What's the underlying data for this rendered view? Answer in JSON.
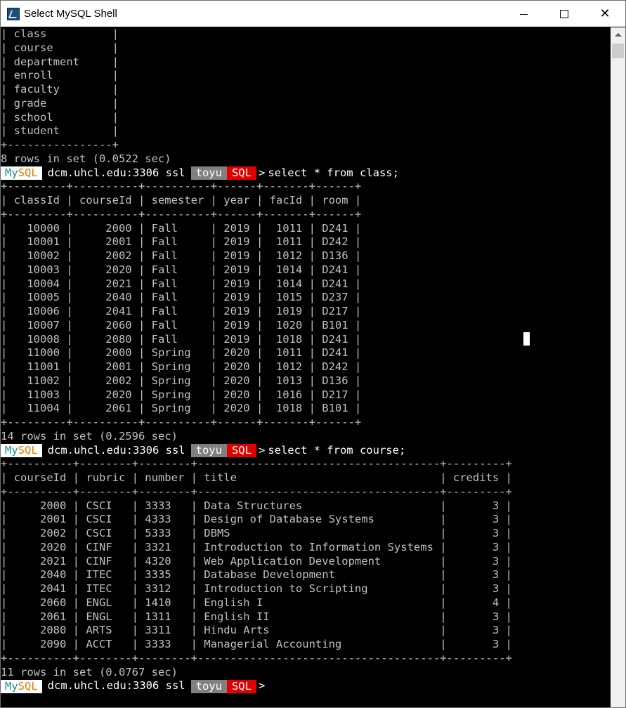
{
  "window": {
    "title": "Select MySQL Shell",
    "minimize_icon": "minimize-icon",
    "maximize_icon": "maximize-icon",
    "close_icon": "close-icon",
    "close_glyph": "✕"
  },
  "prompt": {
    "my": "My",
    "sql": "SQL",
    "host": "dcm.uhcl.edu:3306 ssl",
    "user": "toyu",
    "mode": "SQL",
    "arrow": ">",
    "colors": {
      "my": "#1c8c9c",
      "sql": "#e07b00",
      "user_bg": "#808080",
      "mode_bg": "#e00000"
    }
  },
  "terminal_lines": [
    {
      "type": "text",
      "text": "| class          |"
    },
    {
      "type": "text",
      "text": "| course         |"
    },
    {
      "type": "text",
      "text": "| department     |"
    },
    {
      "type": "text",
      "text": "| enroll         |"
    },
    {
      "type": "text",
      "text": "| faculty        |"
    },
    {
      "type": "text",
      "text": "| grade          |"
    },
    {
      "type": "text",
      "text": "| school         |"
    },
    {
      "type": "text",
      "text": "| student        |"
    },
    {
      "type": "text",
      "text": "+----------------+"
    },
    {
      "type": "text",
      "text": "8 rows in set (0.0522 sec)"
    },
    {
      "type": "prompt",
      "command": "select * from class;"
    },
    {
      "type": "text",
      "text": "+---------+----------+----------+------+-------+------+"
    },
    {
      "type": "text",
      "text": "| classId | courseId | semester | year | facId | room |"
    },
    {
      "type": "text",
      "text": "+---------+----------+----------+------+-------+------+"
    },
    {
      "type": "text",
      "text": "|   10000 |     2000 | Fall     | 2019 |  1011 | D241 |"
    },
    {
      "type": "text",
      "text": "|   10001 |     2001 | Fall     | 2019 |  1011 | D242 |"
    },
    {
      "type": "text",
      "text": "|   10002 |     2002 | Fall     | 2019 |  1012 | D136 |"
    },
    {
      "type": "text",
      "text": "|   10003 |     2020 | Fall     | 2019 |  1014 | D241 |"
    },
    {
      "type": "text",
      "text": "|   10004 |     2021 | Fall     | 2019 |  1014 | D241 |"
    },
    {
      "type": "text",
      "text": "|   10005 |     2040 | Fall     | 2019 |  1015 | D237 |"
    },
    {
      "type": "text",
      "text": "|   10006 |     2041 | Fall     | 2019 |  1019 | D217 |"
    },
    {
      "type": "text",
      "text": "|   10007 |     2060 | Fall     | 2019 |  1020 | B101 |"
    },
    {
      "type": "text",
      "text": "|   10008 |     2080 | Fall     | 2019 |  1018 | D241 |"
    },
    {
      "type": "text",
      "text": "|   11000 |     2000 | Spring   | 2020 |  1011 | D241 |"
    },
    {
      "type": "text",
      "text": "|   11001 |     2001 | Spring   | 2020 |  1012 | D242 |"
    },
    {
      "type": "text",
      "text": "|   11002 |     2002 | Spring   | 2020 |  1013 | D136 |"
    },
    {
      "type": "text",
      "text": "|   11003 |     2020 | Spring   | 2020 |  1016 | D217 |"
    },
    {
      "type": "text",
      "text": "|   11004 |     2061 | Spring   | 2020 |  1018 | B101 |"
    },
    {
      "type": "text",
      "text": "+---------+----------+----------+------+-------+------+"
    },
    {
      "type": "text",
      "text": "14 rows in set (0.2596 sec)"
    },
    {
      "type": "prompt",
      "command": "select * from course;"
    },
    {
      "type": "text",
      "text": "+----------+--------+--------+-------------------------------------+---------+"
    },
    {
      "type": "text",
      "text": "| courseId | rubric | number | title                               | credits |"
    },
    {
      "type": "text",
      "text": "+----------+--------+--------+-------------------------------------+---------+"
    },
    {
      "type": "text",
      "text": "|     2000 | CSCI   | 3333   | Data Structures                     |       3 |"
    },
    {
      "type": "text",
      "text": "|     2001 | CSCI   | 4333   | Design of Database Systems          |       3 |"
    },
    {
      "type": "text",
      "text": "|     2002 | CSCI   | 5333   | DBMS                                |       3 |"
    },
    {
      "type": "text",
      "text": "|     2020 | CINF   | 3321   | Introduction to Information Systems |       3 |"
    },
    {
      "type": "text",
      "text": "|     2021 | CINF   | 4320   | Web Application Development         |       3 |"
    },
    {
      "type": "text",
      "text": "|     2040 | ITEC   | 3335   | Database Development                |       3 |"
    },
    {
      "type": "text",
      "text": "|     2041 | ITEC   | 3312   | Introduction to Scripting           |       3 |"
    },
    {
      "type": "text",
      "text": "|     2060 | ENGL   | 1410   | English I                           |       4 |"
    },
    {
      "type": "text",
      "text": "|     2061 | ENGL   | 1311   | English II                          |       3 |"
    },
    {
      "type": "text",
      "text": "|     2080 | ARTS   | 3311   | Hindu Arts                          |       3 |"
    },
    {
      "type": "text",
      "text": "|     2090 | ACCT   | 3333   | Managerial Accounting               |       3 |"
    },
    {
      "type": "text",
      "text": "+----------+--------+--------+-------------------------------------+---------+"
    },
    {
      "type": "text",
      "text": "11 rows in set (0.0767 sec)"
    },
    {
      "type": "prompt",
      "command": ""
    }
  ]
}
